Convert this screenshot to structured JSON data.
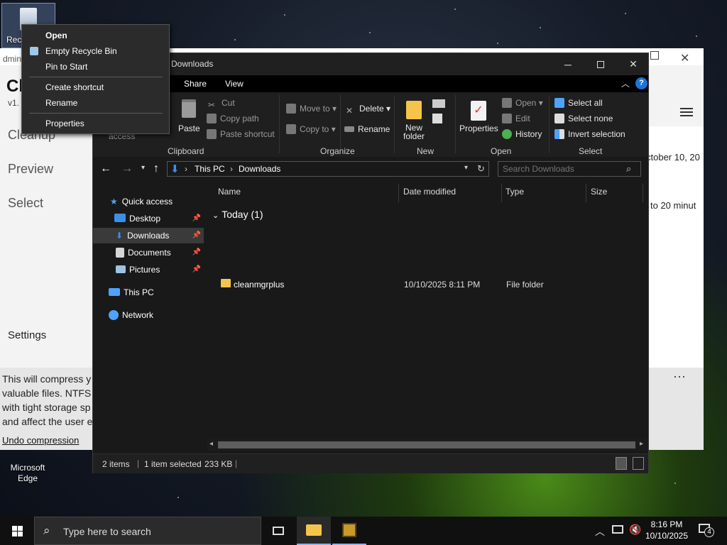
{
  "desktop": {
    "recycle_bin_label": "Rec",
    "edge_label": "Microsoft Edge",
    "admin_partial": "dmin"
  },
  "background_app": {
    "title_partial": "Cl",
    "version_partial": "v1.",
    "nav": [
      "Cleanup",
      "Preview",
      "Select"
    ],
    "settings": "Settings",
    "date_partial": "ctober 10, 20",
    "time_partial": "to 20 minut",
    "banner_lines": [
      "This will compress y",
      "valuable files. NTFS",
      "with tight storage sp",
      "and affect the user e"
    ],
    "undo": "Undo compression",
    "more": "···"
  },
  "context_menu": {
    "items": [
      "Open",
      "Empty Recycle Bin",
      "Pin to Start",
      "Create shortcut",
      "Rename",
      "Properties"
    ]
  },
  "explorer": {
    "title": "Downloads",
    "tabs": [
      "Share",
      "View"
    ],
    "ribbon": {
      "access_partial": "access",
      "paste": "Paste",
      "cut": "Cut",
      "copy_path": "Copy path",
      "paste_shortcut": "Paste shortcut",
      "move_to": "Move to",
      "copy_to": "Copy to",
      "delete": "Delete",
      "rename": "Rename",
      "new_folder_1": "New",
      "new_folder_2": "folder",
      "properties": "Properties",
      "open": "Open",
      "edit": "Edit",
      "history": "History",
      "select_all": "Select all",
      "select_none": "Select none",
      "invert_selection": "Invert selection",
      "groups": [
        "Clipboard",
        "Organize",
        "New",
        "Open",
        "Select"
      ]
    },
    "address": {
      "this_pc": "This PC",
      "downloads": "Downloads",
      "sep": "›"
    },
    "search_placeholder": "Search Downloads",
    "nav_pane": {
      "quick_access": "Quick access",
      "desktop": "Desktop",
      "downloads": "Downloads",
      "documents": "Documents",
      "pictures": "Pictures",
      "this_pc": "This PC",
      "network": "Network"
    },
    "columns": [
      "Name",
      "Date modified",
      "Type",
      "Size"
    ],
    "group_header": "Today (1)",
    "files": [
      {
        "name": "cleanmgrplus",
        "date": "10/10/2025 8:11 PM",
        "type": "File folder"
      }
    ],
    "status": {
      "items": "2 items",
      "selected": "1 item selected",
      "size": "233 KB"
    }
  },
  "taskbar": {
    "search_placeholder": "Type here to search",
    "time": "8:16 PM",
    "date": "10/10/2025",
    "notifications": "4"
  },
  "colors": {
    "accent": "#0078d7",
    "folder": "#f4c54a",
    "select_blue": "#4ea3ff"
  }
}
